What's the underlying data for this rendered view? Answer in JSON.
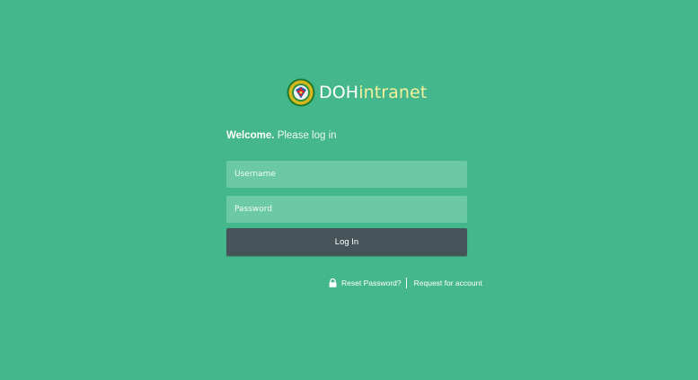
{
  "brand": {
    "logo_icon": "doh-seal-icon",
    "name_part1": "DOH",
    "name_part2": "intranet"
  },
  "welcome": {
    "bold": "Welcome.",
    "text": "Please log in"
  },
  "form": {
    "username_placeholder": "Username",
    "password_placeholder": "Password",
    "login_label": "Log In"
  },
  "links": {
    "lock_icon": "lock-icon",
    "reset_label": "Reset Password?",
    "request_label": "Request for account"
  },
  "colors": {
    "background": "#45b78d",
    "input_background": "#6cc9a7",
    "button_background": "#46545a",
    "brand_accent": "#f5f09a"
  }
}
